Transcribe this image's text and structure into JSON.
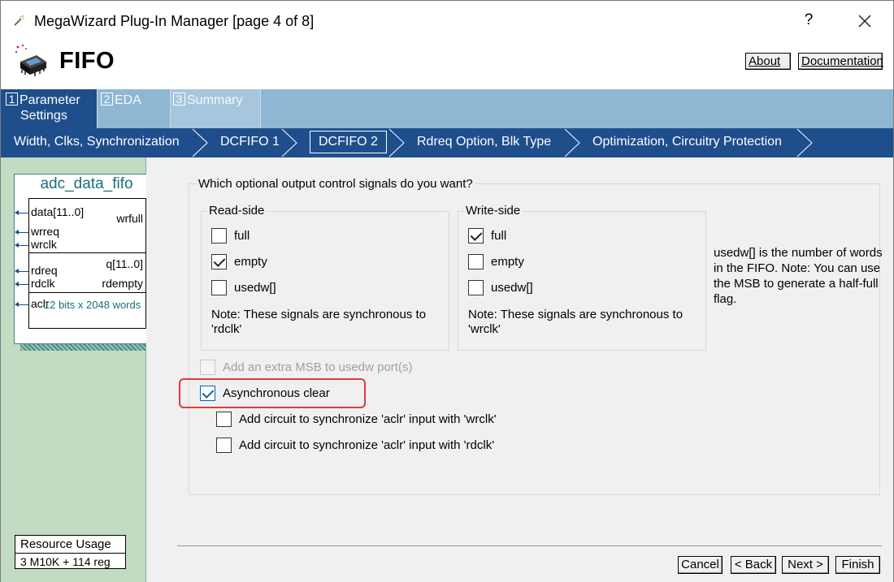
{
  "window": {
    "title": "MegaWizard Plug-In Manager [page 4 of 8]",
    "help_label": "?"
  },
  "header": {
    "title": "FIFO",
    "about_label": "About",
    "documentation_label": "Documentation"
  },
  "tabs": [
    {
      "num": "1",
      "label": "Parameter",
      "label2": "Settings",
      "active": true
    },
    {
      "num": "2",
      "label": "EDA",
      "active": false
    },
    {
      "num": "3",
      "label": "Summary",
      "active": false
    }
  ],
  "breadcrumbs": [
    {
      "label": "Width, Clks, Synchronization",
      "active": false
    },
    {
      "label": "DCFIFO 1",
      "active": false
    },
    {
      "label": "DCFIFO 2",
      "active": true
    },
    {
      "label": "Rdreq Option, Blk Type",
      "active": false
    },
    {
      "label": "Optimization, Circuitry Protection",
      "active": false
    }
  ],
  "symbol": {
    "name": "adc_data_fifo",
    "pins_left": [
      "data[11..0]",
      "wrreq",
      "wrclk",
      "rdreq",
      "rdclk",
      "aclr"
    ],
    "pins_right": [
      "wrfull",
      "q[11..0]",
      "rdempty"
    ],
    "words_label": "12 bits x 2048 words"
  },
  "resource": {
    "title": "Resource Usage",
    "value": "3 M10K + 114 reg"
  },
  "main": {
    "question": "Which optional output control signals do you want?",
    "read_side": {
      "label": "Read-side",
      "options": [
        {
          "label": "full",
          "checked": false
        },
        {
          "label": "empty",
          "checked": true
        },
        {
          "label": "usedw[]",
          "checked": false
        }
      ],
      "note": "Note: These signals are synchronous to 'rdclk'"
    },
    "write_side": {
      "label": "Write-side",
      "options": [
        {
          "label": "full",
          "checked": true
        },
        {
          "label": "empty",
          "checked": false
        },
        {
          "label": "usedw[]",
          "checked": false
        }
      ],
      "note": "Note: These signals are synchronous to 'wrclk'"
    },
    "usedw_note": "usedw[] is the number of words in the FIFO. Note: You can use the MSB to generate a half-full flag.",
    "extra_msb": {
      "label": "Add an extra MSB to usedw port(s)",
      "checked": false,
      "disabled": true
    },
    "async_clear": {
      "label": "Asynchronous clear",
      "checked": true
    },
    "sync_wrclk": {
      "label": "Add circuit to synchronize 'aclr' input with 'wrclk'",
      "checked": false
    },
    "sync_rdclk": {
      "label": "Add circuit to synchronize 'aclr' input with 'rdclk'",
      "checked": false
    }
  },
  "footer": {
    "cancel_label": "Cancel",
    "back_label": "< Back",
    "next_label": "Next >",
    "finish_label": "Finish"
  },
  "colors": {
    "nav_blue": "#1e4e8c",
    "tab_light_blue": "#8fb7d4",
    "left_pane_green": "#c1dcc3",
    "highlight_red": "#e23a3a",
    "checkbox_blue": "#0a64ad"
  },
  "icons": {
    "window": "wand-icon",
    "close": "close-icon",
    "header_logo": "chip-icon",
    "breadcrumb_separator": "chevron-right-icon"
  }
}
